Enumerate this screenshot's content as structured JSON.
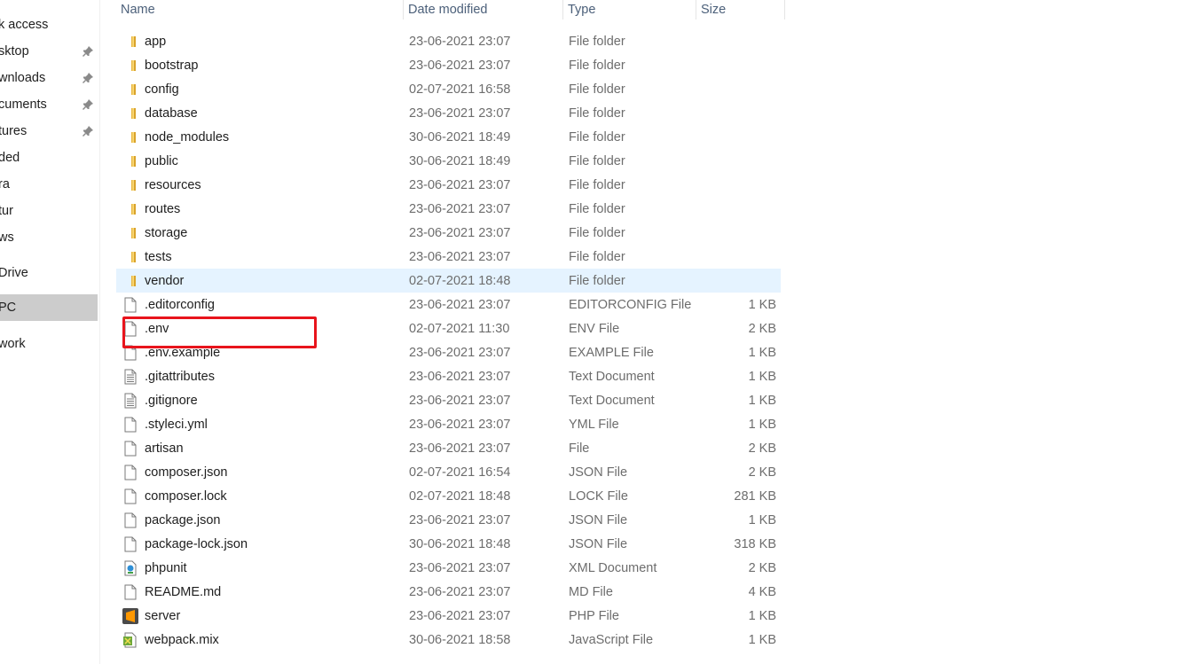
{
  "sidebar": {
    "items": [
      {
        "label": "k access",
        "pinned": false
      },
      {
        "label": "sktop",
        "pinned": true
      },
      {
        "label": "wnloads",
        "pinned": true
      },
      {
        "label": "cuments",
        "pinned": true
      },
      {
        "label": "tures",
        "pinned": true
      },
      {
        "label": "ded",
        "pinned": false
      },
      {
        "label": "ra",
        "pinned": false
      },
      {
        "label": "tur",
        "pinned": false
      },
      {
        "label": "ws",
        "pinned": false
      },
      {
        "label": "Drive",
        "pinned": false
      },
      {
        "label": "PC",
        "pinned": false,
        "selected": true
      },
      {
        "label": "work",
        "pinned": false
      }
    ]
  },
  "columns": {
    "name": "Name",
    "date": "Date modified",
    "type": "Type",
    "size": "Size"
  },
  "files": [
    {
      "name": "app",
      "date": "23-06-2021 23:07",
      "type": "File folder",
      "size": "",
      "icon": "folder-icon"
    },
    {
      "name": "bootstrap",
      "date": "23-06-2021 23:07",
      "type": "File folder",
      "size": "",
      "icon": "folder-icon"
    },
    {
      "name": "config",
      "date": "02-07-2021 16:58",
      "type": "File folder",
      "size": "",
      "icon": "folder-icon"
    },
    {
      "name": "database",
      "date": "23-06-2021 23:07",
      "type": "File folder",
      "size": "",
      "icon": "folder-icon"
    },
    {
      "name": "node_modules",
      "date": "30-06-2021 18:49",
      "type": "File folder",
      "size": "",
      "icon": "folder-icon"
    },
    {
      "name": "public",
      "date": "30-06-2021 18:49",
      "type": "File folder",
      "size": "",
      "icon": "folder-icon"
    },
    {
      "name": "resources",
      "date": "23-06-2021 23:07",
      "type": "File folder",
      "size": "",
      "icon": "folder-icon"
    },
    {
      "name": "routes",
      "date": "23-06-2021 23:07",
      "type": "File folder",
      "size": "",
      "icon": "folder-icon"
    },
    {
      "name": "storage",
      "date": "23-06-2021 23:07",
      "type": "File folder",
      "size": "",
      "icon": "folder-icon"
    },
    {
      "name": "tests",
      "date": "23-06-2021 23:07",
      "type": "File folder",
      "size": "",
      "icon": "folder-icon"
    },
    {
      "name": "vendor",
      "date": "02-07-2021 18:48",
      "type": "File folder",
      "size": "",
      "icon": "folder-icon",
      "hover": true
    },
    {
      "name": ".editorconfig",
      "date": "23-06-2021 23:07",
      "type": "EDITORCONFIG File",
      "size": "1 KB",
      "icon": "file-icon"
    },
    {
      "name": ".env",
      "date": "02-07-2021 11:30",
      "type": "ENV File",
      "size": "2 KB",
      "icon": "file-icon"
    },
    {
      "name": ".env.example",
      "date": "23-06-2021 23:07",
      "type": "EXAMPLE File",
      "size": "1 KB",
      "icon": "file-icon"
    },
    {
      "name": ".gitattributes",
      "date": "23-06-2021 23:07",
      "type": "Text Document",
      "size": "1 KB",
      "icon": "text-file-icon"
    },
    {
      "name": ".gitignore",
      "date": "23-06-2021 23:07",
      "type": "Text Document",
      "size": "1 KB",
      "icon": "text-file-icon"
    },
    {
      "name": ".styleci.yml",
      "date": "23-06-2021 23:07",
      "type": "YML File",
      "size": "1 KB",
      "icon": "file-icon"
    },
    {
      "name": "artisan",
      "date": "23-06-2021 23:07",
      "type": "File",
      "size": "2 KB",
      "icon": "file-icon"
    },
    {
      "name": "composer.json",
      "date": "02-07-2021 16:54",
      "type": "JSON File",
      "size": "2 KB",
      "icon": "file-icon"
    },
    {
      "name": "composer.lock",
      "date": "02-07-2021 18:48",
      "type": "LOCK File",
      "size": "281 KB",
      "icon": "file-icon"
    },
    {
      "name": "package.json",
      "date": "23-06-2021 23:07",
      "type": "JSON File",
      "size": "1 KB",
      "icon": "file-icon"
    },
    {
      "name": "package-lock.json",
      "date": "30-06-2021 18:48",
      "type": "JSON File",
      "size": "318 KB",
      "icon": "file-icon"
    },
    {
      "name": "phpunit",
      "date": "23-06-2021 23:07",
      "type": "XML Document",
      "size": "2 KB",
      "icon": "xml-file-icon"
    },
    {
      "name": "README.md",
      "date": "23-06-2021 23:07",
      "type": "MD File",
      "size": "4 KB",
      "icon": "file-icon"
    },
    {
      "name": "server",
      "date": "23-06-2021 23:07",
      "type": "PHP File",
      "size": "1 KB",
      "icon": "sublime-icon"
    },
    {
      "name": "webpack.mix",
      "date": "30-06-2021 18:58",
      "type": "JavaScript File",
      "size": "1 KB",
      "icon": "js-file-icon"
    }
  ],
  "colors": {
    "highlight": "#e8141c",
    "selection": "#e5f3ff",
    "folder": "#f5c542"
  }
}
